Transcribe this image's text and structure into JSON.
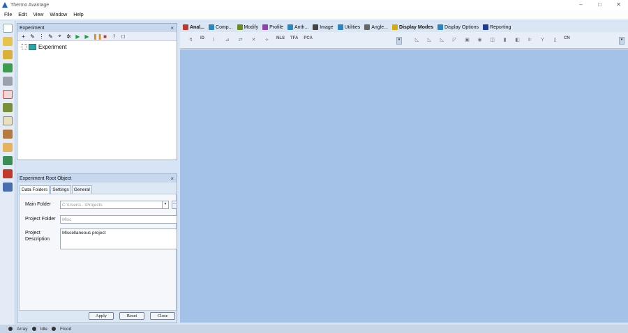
{
  "window": {
    "title": "Thermo Avantage",
    "controls": [
      "–",
      "□",
      "✕"
    ]
  },
  "menu": [
    "File",
    "Edit",
    "View",
    "Window",
    "Help"
  ],
  "experiment_panel": {
    "title": "Experiment",
    "close": "×",
    "toolbar_icons": [
      "+",
      "✎",
      "⋮",
      "✎",
      "⌖",
      "✲",
      "▶",
      "▶",
      "❚❚",
      "■",
      "!",
      "□"
    ],
    "tree_root": "Experiment"
  },
  "root_panel": {
    "title": "Experiment Root Object",
    "close": "×",
    "tabs": [
      "Data Folders",
      "Settings",
      "General"
    ],
    "main_folder_label": "Main Folder",
    "main_folder_value": "C:\\Users\\...\\Projects",
    "project_folder_label": "Project Folder",
    "project_folder_value": "Misc",
    "project_description_label": "Project Description",
    "project_description_value": "Miscellaneous project",
    "buttons": {
      "apply": "Apply",
      "reset": "Reset",
      "close": "Close"
    }
  },
  "ribbon": {
    "tabs": [
      {
        "label": "Anal...",
        "icon": "peak-fit-icon",
        "color": "#c0392b"
      },
      {
        "label": "Comp...",
        "icon": "compare-icon",
        "color": "#2e86c1"
      },
      {
        "label": "Modify",
        "icon": "modify-icon",
        "color": "#6b8e23"
      },
      {
        "label": "Profile",
        "icon": "profile-icon",
        "color": "#8e44ad"
      },
      {
        "label": "Anth...",
        "icon": "grid-icon",
        "color": "#2e86c1"
      },
      {
        "label": "Image",
        "icon": "image-icon",
        "color": "#444444"
      },
      {
        "label": "Utilities",
        "icon": "utilities-icon",
        "color": "#2e86c1"
      },
      {
        "label": "Angle...",
        "icon": "angle-icon",
        "color": "#666666"
      },
      {
        "label": "Display Modes",
        "icon": "display-modes-icon",
        "color": "#d4ac0d"
      },
      {
        "label": "Display Options",
        "icon": "display-options-icon",
        "color": "#2e86c1"
      },
      {
        "label": "Reporting",
        "icon": "reporting-icon",
        "color": "#1f3a93"
      }
    ],
    "left_tools": [
      "↯",
      "ID",
      "⌇",
      "⊿",
      "⇄",
      "✕",
      "⟡",
      "NLS",
      "TFA",
      "PCA"
    ],
    "right_tools": [
      "◺",
      "◺",
      "◺",
      "◸",
      "▣",
      "◉",
      "◫",
      "▮",
      "◧",
      "⊫",
      "Y",
      "▯",
      "CN"
    ]
  },
  "status": [
    "Array",
    "Idle",
    "Flood"
  ],
  "colors": {
    "workspace": "#a4c2e8",
    "panel_header": "#c7d8ee",
    "play_green": "#1e9e3e",
    "stop_red": "#c0392b"
  }
}
